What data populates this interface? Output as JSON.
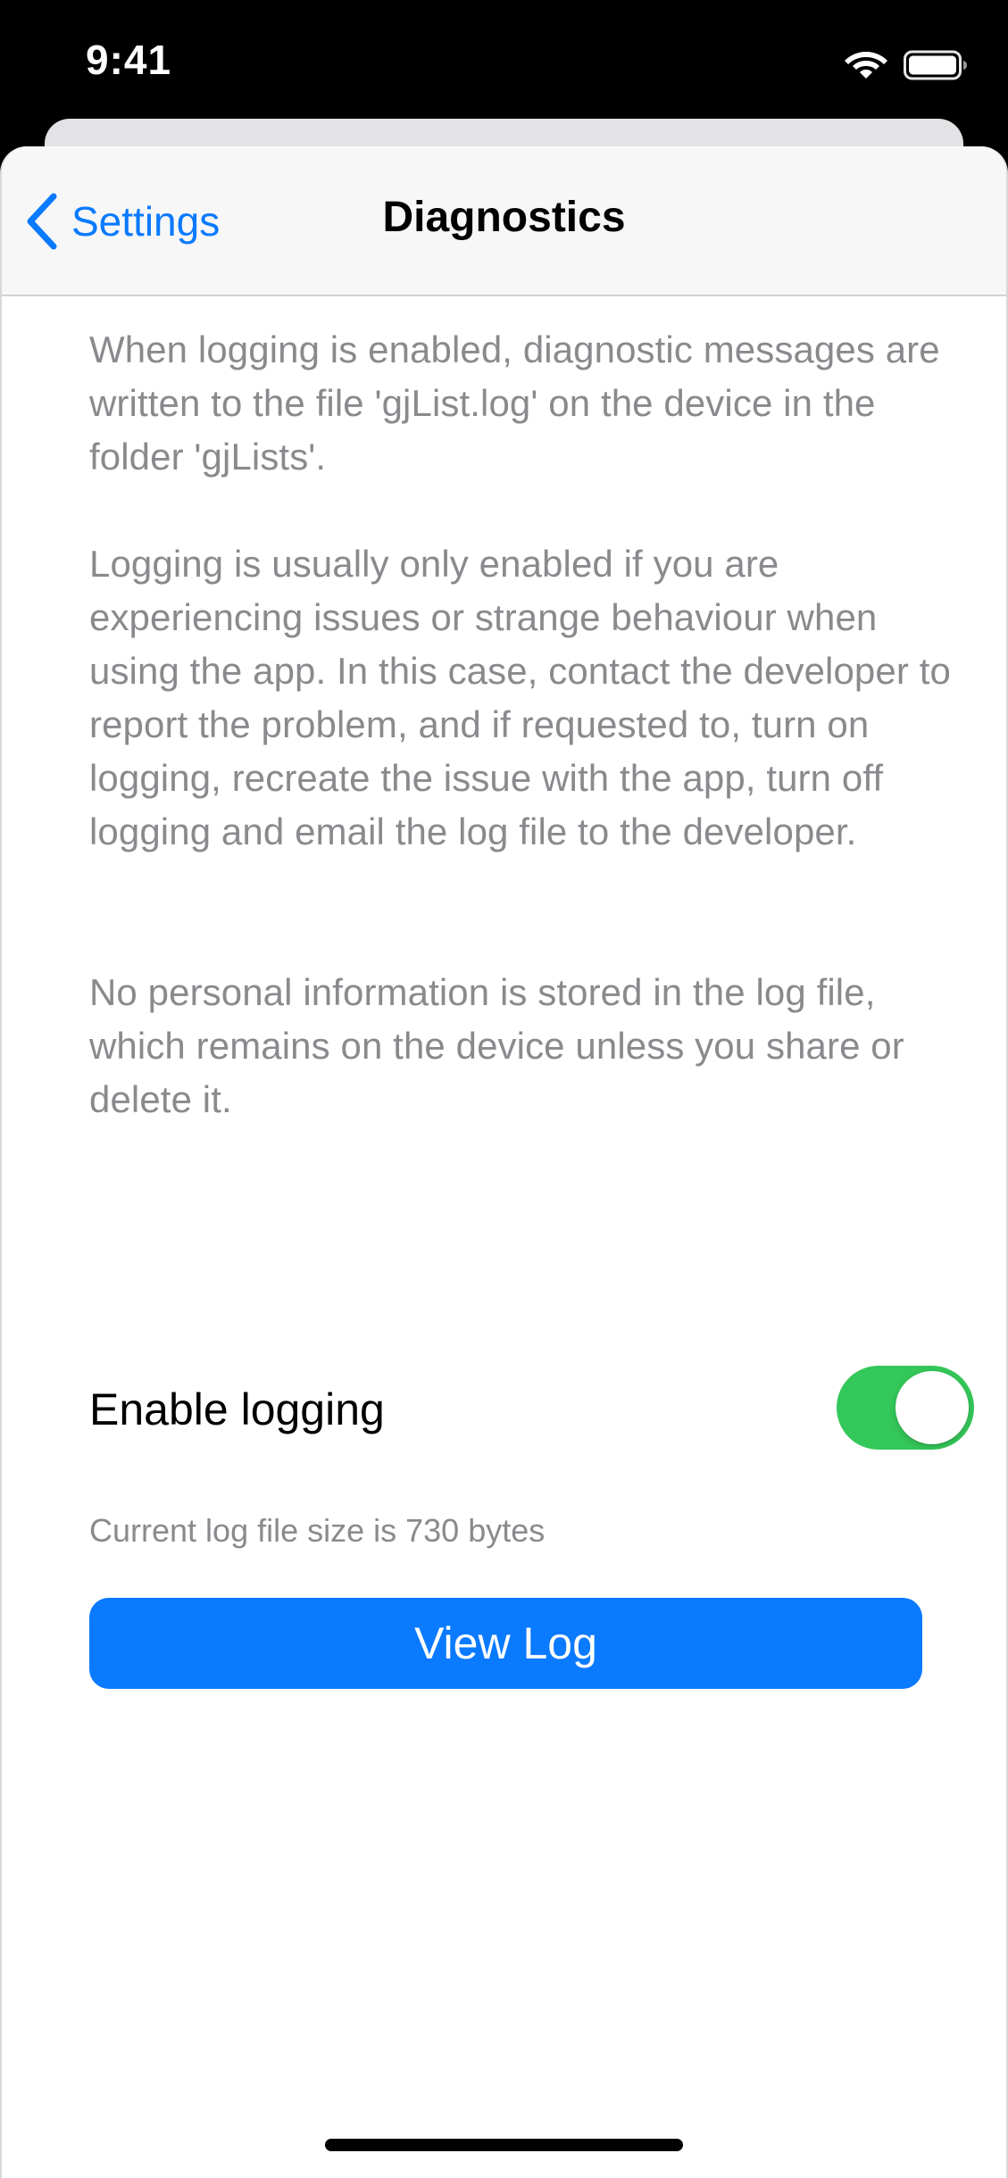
{
  "status_bar": {
    "time": "9:41",
    "icons": [
      "wifi-icon",
      "battery-icon"
    ]
  },
  "nav": {
    "back_label": "Settings",
    "back_icon": "chevron-left-icon",
    "title": "Diagnostics"
  },
  "content": {
    "paragraphs": [
      "When logging is enabled, diagnostic messages are written to the file 'gjList.log' on the device in the folder 'gjLists'.",
      "Logging is usually only enabled if you are experiencing issues or strange behaviour when using the app. In this case, contact the developer to report the problem, and if requested to, turn on logging, recreate the issue with the app, turn off logging and email the log file to the developer.",
      "No personal information is stored in the log file, which remains on the device unless you share or delete it."
    ],
    "toggle": {
      "label": "Enable logging",
      "on": true
    },
    "log_size_text": "Current log file size is 730 bytes",
    "view_log_label": "View Log"
  },
  "colors": {
    "accent": "#0a7aff",
    "switch_on": "#34c759",
    "secondary_text": "#8a8a8e"
  }
}
